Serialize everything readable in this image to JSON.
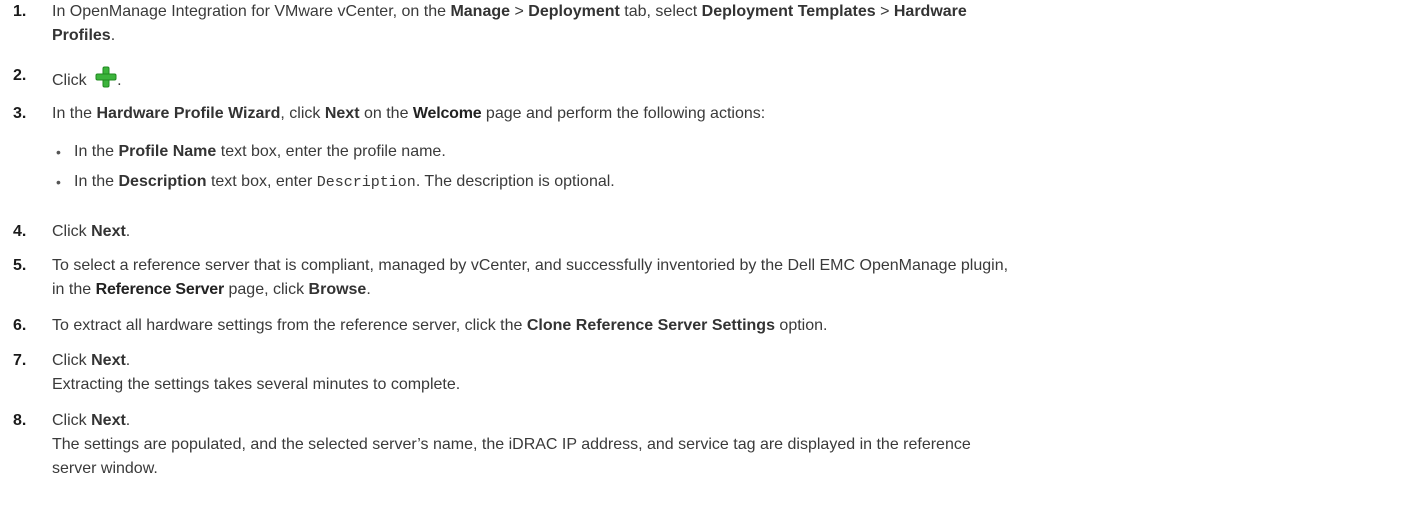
{
  "steps": [
    {
      "number": "1.",
      "parts": {
        "a": "In OpenManage Integration for VMware vCenter, on the ",
        "b": "Manage",
        "c": " > ",
        "d": "Deployment",
        "e": " tab, select ",
        "f": "Deployment Templates",
        "g": " > ",
        "h": "Hardware",
        "i": "Profiles",
        "j": "."
      }
    },
    {
      "number": "2.",
      "parts": {
        "a": "Click ",
        "b": "."
      },
      "icon": "green-plus-icon"
    },
    {
      "number": "3.",
      "parts": {
        "a": "In the ",
        "b": "Hardware Profile Wizard",
        "c": ", click ",
        "d": "Next",
        "e": " on the ",
        "f": "Welcome",
        "g": " page and perform the following actions:"
      },
      "bullets": [
        {
          "a": "In the ",
          "b": "Profile Name",
          "c": " text box, enter the profile name."
        },
        {
          "a": "In the ",
          "b": "Description",
          "c": " text box, enter ",
          "d": "Description",
          "e": ". The description is optional."
        }
      ]
    },
    {
      "number": "4.",
      "parts": {
        "a": "Click ",
        "b": "Next",
        "c": "."
      }
    },
    {
      "number": "5.",
      "parts": {
        "a": "To select a reference server that is compliant, managed by vCenter, and successfully inventoried by the Dell EMC OpenManage plugin,",
        "b": "in the ",
        "c": "Reference Server",
        "d": " page, click ",
        "e": "Browse",
        "f": "."
      }
    },
    {
      "number": "6.",
      "parts": {
        "a": "To extract all hardware settings from the reference server, click the ",
        "b": "Clone Reference Server Settings",
        "c": " option."
      }
    },
    {
      "number": "7.",
      "parts": {
        "a": "Click ",
        "b": "Next",
        "c": "."
      },
      "note": "Extracting the settings takes several minutes to complete."
    },
    {
      "number": "8.",
      "parts": {
        "a": "Click ",
        "b": "Next",
        "c": "."
      },
      "note_lines": [
        "The settings are populated, and the selected server’s name, the iDRAC IP address, and service tag are displayed in the reference",
        "server window."
      ]
    }
  ],
  "colors": {
    "icon_green": "#3cb43c",
    "text": "#3a3a3a"
  }
}
